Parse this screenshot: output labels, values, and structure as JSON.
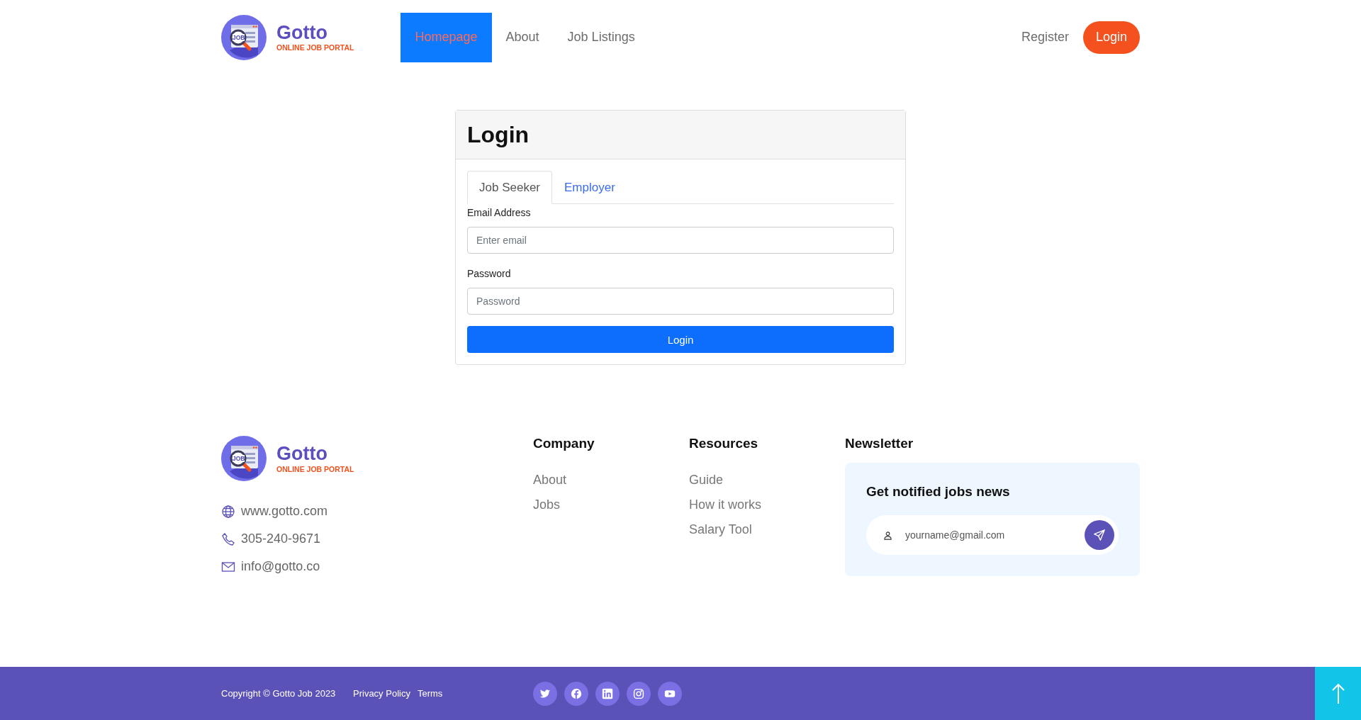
{
  "header": {
    "logo": {
      "badge": "JOB",
      "name": "Gotto",
      "tagline": "ONLINE JOB PORTAL"
    },
    "nav": [
      {
        "label": "Homepage",
        "selected": true
      },
      {
        "label": "About",
        "selected": false
      },
      {
        "label": "Job Listings",
        "selected": false
      }
    ],
    "actions": [
      {
        "label": "Register",
        "kind": "link"
      },
      {
        "label": "Login",
        "kind": "pill"
      }
    ]
  },
  "login_card": {
    "title": "Login",
    "tabs": [
      {
        "label": "Job Seeker",
        "selected": true
      },
      {
        "label": "Employer",
        "selected": false
      }
    ],
    "fields": [
      {
        "label": "Email Address",
        "placeholder": "Enter email"
      },
      {
        "label": "Password",
        "placeholder": "Password"
      }
    ],
    "submit": "Login"
  },
  "footer": {
    "logo": {
      "badge": "JOB",
      "name": "Gotto",
      "tagline": "ONLINE JOB PORTAL"
    },
    "contacts": [
      {
        "kind": "web",
        "text": "www.gotto.com"
      },
      {
        "kind": "phone",
        "text": "305-240-9671"
      },
      {
        "kind": "mail",
        "text": "info@gotto.co"
      }
    ],
    "columns": [
      {
        "title": "Company",
        "links": [
          "About",
          "Jobs"
        ]
      },
      {
        "title": "Resources",
        "links": [
          "Guide",
          "How it works",
          "Salary Tool"
        ]
      }
    ],
    "newsletter": {
      "title": "Newsletter",
      "heading": "Get notified jobs news",
      "placeholder": "yourname@gmail.com"
    }
  },
  "bottom_bar": {
    "copyright": "Copyright © Gotto Job 2023",
    "links": [
      "Privacy Policy",
      "Terms"
    ],
    "social": [
      {
        "kind": "twitter"
      },
      {
        "kind": "facebook"
      },
      {
        "kind": "linkedin"
      },
      {
        "kind": "instagram"
      },
      {
        "kind": "youtube"
      }
    ]
  }
}
